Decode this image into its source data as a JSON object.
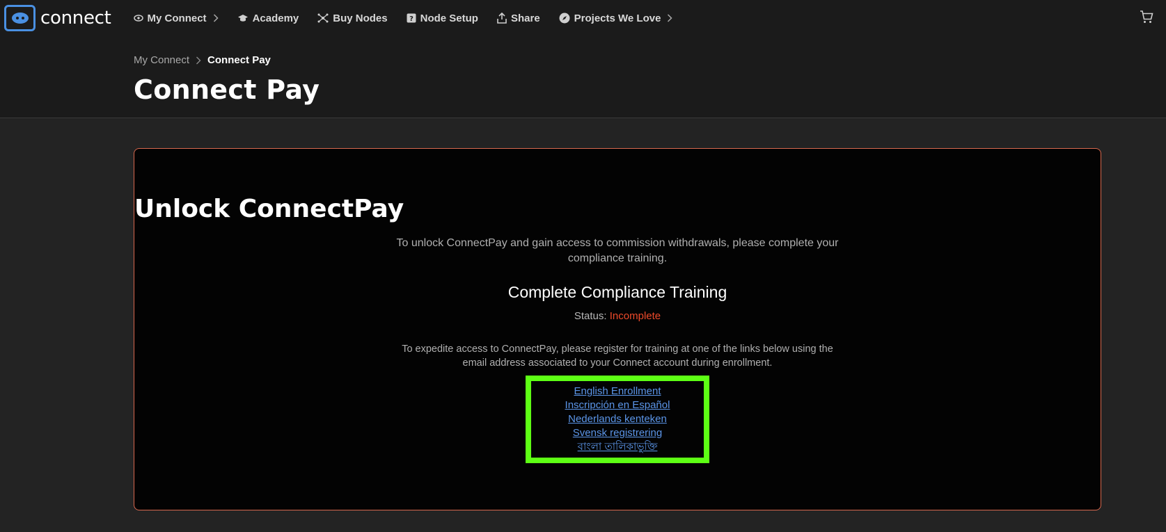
{
  "brand": {
    "name": "connect",
    "logo_icon": "eye-logo-icon",
    "accent": "#4a90e2"
  },
  "nav": {
    "items": [
      {
        "label": "My Connect",
        "icon": "eye-icon",
        "has_chevron": true
      },
      {
        "label": "Academy",
        "icon": "graduation-cap-icon",
        "has_chevron": false
      },
      {
        "label": "Buy Nodes",
        "icon": "network-nodes-icon",
        "has_chevron": false
      },
      {
        "label": "Node Setup",
        "icon": "help-box-icon",
        "has_chevron": false
      },
      {
        "label": "Share",
        "icon": "share-upload-icon",
        "has_chevron": false
      },
      {
        "label": "Projects We Love",
        "icon": "compass-icon",
        "has_chevron": true
      }
    ],
    "cart_icon": "cart-icon"
  },
  "breadcrumb": {
    "parent": "My Connect",
    "current": "Connect Pay"
  },
  "page": {
    "title": "Connect Pay"
  },
  "card": {
    "title": "Unlock ConnectPay",
    "description": "To unlock ConnectPay and gain access to commission withdrawals, please complete your compliance training.",
    "section_title": "Complete Compliance Training",
    "status_label": "Status:",
    "status_value": "Incomplete",
    "status_color": "#ee4a2a",
    "expedite_text": "To expedite access to ConnectPay, please register for training at one of the links below using the email address associated to your Connect account during enrollment.",
    "border_color": "#d8684e",
    "links": [
      "English Enrollment",
      "Inscripción en Español",
      "Nederlands kenteken",
      "Svensk registrering",
      "বাংলা তালিকাভুক্তি"
    ],
    "highlight_color": "#5dff14"
  }
}
